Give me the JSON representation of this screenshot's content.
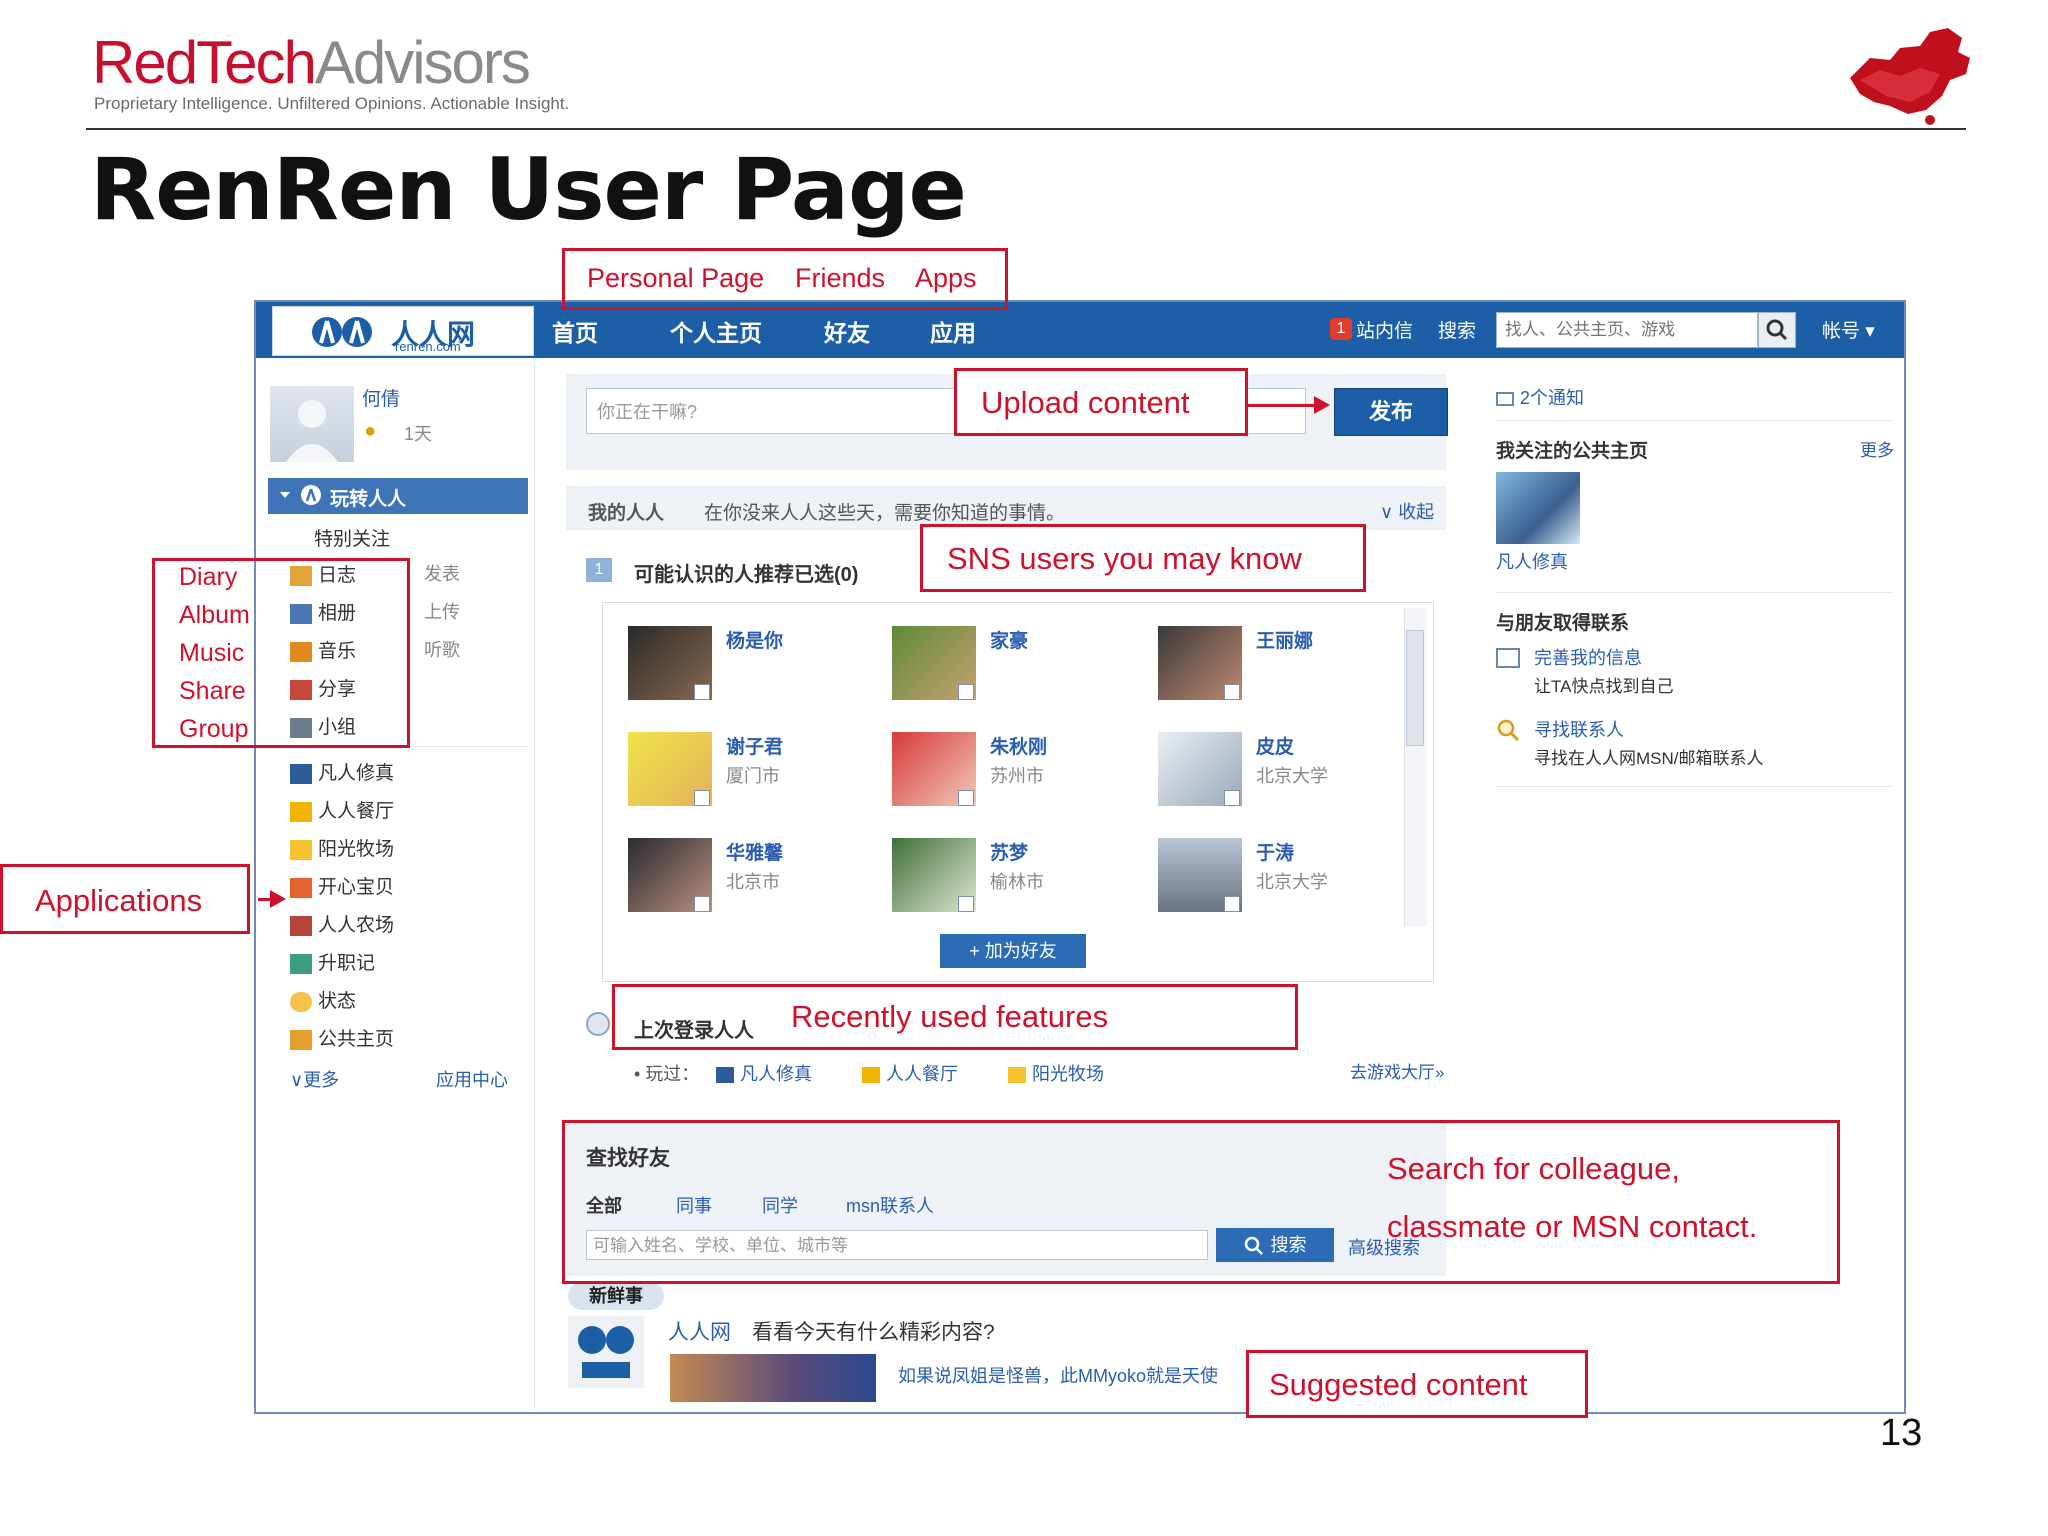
{
  "header": {
    "brand_red": "RedTech",
    "brand_grey": "Advisors",
    "tagline": "Proprietary Intelligence.  Unfiltered Opinions.  Actionable Insight.",
    "slide_title": "RenRen User Page",
    "page_number": "13"
  },
  "renren": {
    "logo_text": "人人网",
    "logo_sub": "renren.com",
    "nav": [
      "首页",
      "个人主页",
      "好友",
      "应用"
    ],
    "top_right": {
      "badge": "1",
      "inbox": "站内信",
      "search": "搜索",
      "search_placeholder": "找人、公共主页、游戏",
      "account": "帐号"
    },
    "user": {
      "name": "何倩",
      "level": "1天"
    },
    "sidebar": {
      "header": "玩转人人",
      "special": "特别关注",
      "items": [
        {
          "label": "日志",
          "action": "发表"
        },
        {
          "label": "相册",
          "action": "上传"
        },
        {
          "label": "音乐",
          "action": "听歌"
        },
        {
          "label": "分享",
          "action": ""
        },
        {
          "label": "小组",
          "action": ""
        }
      ],
      "apps": [
        "凡人修真",
        "人人餐厅",
        "阳光牧场",
        "开心宝贝",
        "人人农场",
        "升职记",
        "状态",
        "公共主页"
      ],
      "more": "更多",
      "app_center": "应用中心"
    },
    "compose": {
      "placeholder": "你正在干嘛?",
      "publish": "发布"
    },
    "my_renren": {
      "title": "我的人人",
      "tip": "在你没来人人这些天，需要你知道的事情。",
      "collapse": "收起"
    },
    "recommend": {
      "title": "可能认识的人推荐已选(0)",
      "people": [
        {
          "name": "杨是你",
          "city": ""
        },
        {
          "name": "家豪",
          "city": ""
        },
        {
          "name": "王丽娜",
          "city": ""
        },
        {
          "name": "谢子君",
          "city": "厦门市"
        },
        {
          "name": "朱秋刚",
          "city": "苏州市"
        },
        {
          "name": "皮皮",
          "city": "北京大学"
        },
        {
          "name": "华雅馨",
          "city": "北京市"
        },
        {
          "name": "苏梦",
          "city": "榆林市"
        },
        {
          "name": "于涛",
          "city": "北京大学"
        }
      ],
      "add_friend": "+ 加为好友"
    },
    "recent": {
      "title": "上次登录人人",
      "played_label": "玩过：",
      "games": [
        "凡人修真",
        "人人餐厅",
        "阳光牧场"
      ],
      "game_hall": "去游戏大厅»"
    },
    "find_friends": {
      "title": "查找好友",
      "tabs": [
        "全部",
        "同事",
        "同学",
        "msn联系人"
      ],
      "placeholder": "可输入姓名、学校、单位、城市等",
      "search": "搜索",
      "advanced": "高级搜索"
    },
    "news": {
      "tag": "新鲜事",
      "headline_src": "人人网",
      "headline": "看看今天有什么精彩内容?",
      "teaser": "如果说凤姐是怪兽，此MMyoko就是天使"
    },
    "right": {
      "notifications": "2个通知",
      "followed_pages": "我关注的公共主页",
      "more": "更多",
      "page_name": "凡人修真",
      "contact_title": "与朋友取得联系",
      "complete_info": "完善我的信息",
      "complete_info_sub": "让TA快点找到自己",
      "find_contacts": "寻找联系人",
      "find_contacts_sub": "寻找在人人网MSN/邮箱联系人"
    }
  },
  "callouts": {
    "top_nav": [
      "Personal Page",
      "Friends",
      "Apps"
    ],
    "upload": "Upload content",
    "sns": "SNS users you may know",
    "recent": "Recently used features",
    "search": [
      "Search for colleague,",
      "classmate or MSN contact."
    ],
    "suggested": "Suggested content",
    "applications": "Applications",
    "left_list": [
      "Diary",
      "Album",
      "Music",
      "Share",
      "Group"
    ]
  },
  "colors": {
    "brand_red": "#c8102e",
    "renren_blue": "#1d5fa7",
    "callout_red": "#d0112b"
  }
}
